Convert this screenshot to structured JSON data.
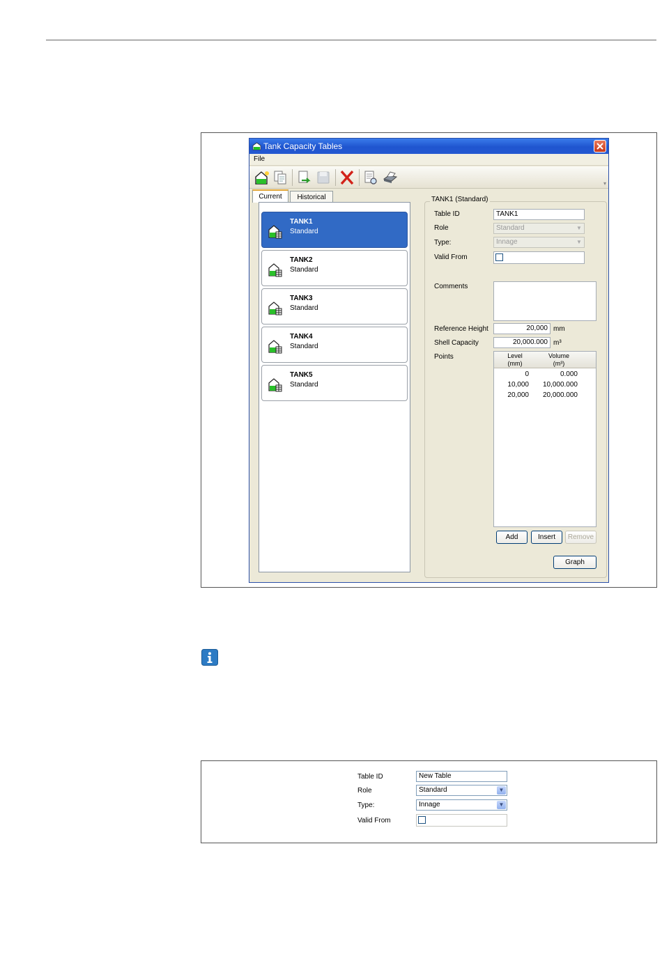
{
  "window": {
    "title": "Tank Capacity Tables",
    "menu": {
      "file": "File"
    }
  },
  "tabs": [
    {
      "label": "Current"
    },
    {
      "label": "Historical"
    }
  ],
  "tanks": [
    {
      "name": "TANK1",
      "role": "Standard",
      "selected": true
    },
    {
      "name": "TANK2",
      "role": "Standard"
    },
    {
      "name": "TANK3",
      "role": "Standard"
    },
    {
      "name": "TANK4",
      "role": "Standard"
    },
    {
      "name": "TANK5",
      "role": "Standard"
    }
  ],
  "details": {
    "group_title": "TANK1 (Standard)",
    "table_id_label": "Table ID",
    "table_id": "TANK1",
    "role_label": "Role",
    "role": "Standard",
    "type_label": "Type:",
    "type": "Innage",
    "valid_from_label": "Valid From",
    "comments_label": "Comments",
    "reference_height_label": "Reference Height",
    "reference_height": "20,000",
    "reference_height_unit": "mm",
    "shell_capacity_label": "Shell Capacity",
    "shell_capacity": "20,000.000",
    "shell_capacity_unit": "m³",
    "points_label": "Points",
    "points_columns": [
      "Level\n(mm)",
      "Volume\n(m³)"
    ],
    "points": [
      {
        "level": "0",
        "volume": "0.000"
      },
      {
        "level": "10,000",
        "volume": "10,000.000"
      },
      {
        "level": "20,000",
        "volume": "20,000.000"
      }
    ],
    "add_label": "Add",
    "insert_label": "Insert",
    "remove_label": "Remove",
    "graph_label": "Graph"
  },
  "new_table": {
    "table_id_label": "Table ID",
    "table_id": "New Table",
    "role_label": "Role",
    "role": "Standard",
    "type_label": "Type:",
    "type": "Innage",
    "valid_from_label": "Valid From"
  }
}
